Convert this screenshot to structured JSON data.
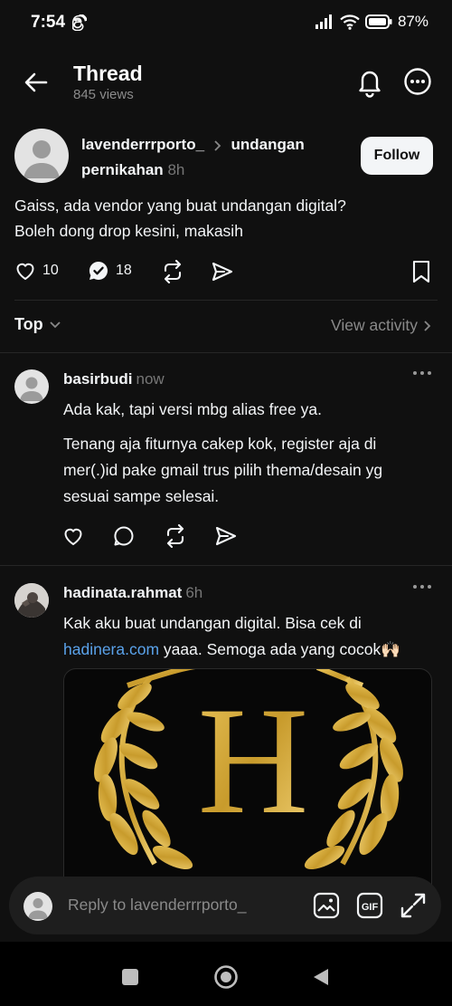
{
  "status": {
    "time": "7:54",
    "battery": "87%"
  },
  "header": {
    "title": "Thread",
    "views": "845 views"
  },
  "op": {
    "username": "lavenderrrporto_",
    "topic_line1": "undangan",
    "topic_line2": "pernikahan",
    "time": "8h",
    "follow_label": "Follow",
    "text_line1": "Gaiss, ada vendor yang buat undangan digital?",
    "text_line2": "Boleh dong drop kesini, makasih",
    "likes": "10",
    "replies": "18"
  },
  "sort": {
    "label": "Top",
    "view_activity": "View activity"
  },
  "comments": [
    {
      "username": "basirbudi",
      "time": "now",
      "line1": "Ada kak, tapi versi mbg alias free ya.",
      "line2": "Tenang aja fiturnya cakep kok, register aja di",
      "line3": "mer(.)id pake gmail trus pilih thema/desain yg",
      "line4": "sesuai sampe selesai."
    },
    {
      "username": "hadinata.rahmat",
      "time": "6h",
      "line1": "Kak aku buat undangan digital. Bisa cek di",
      "link": "hadinera.com",
      "line2_rest": " yaaa. Semoga ada yang cocok🙌🏻",
      "image_letter": "H"
    }
  ],
  "reply": {
    "placeholder": "Reply to lavenderrrporto_"
  },
  "colors": {
    "background": "#101010",
    "link": "#5aa2ea",
    "gold": "#c9a227"
  }
}
